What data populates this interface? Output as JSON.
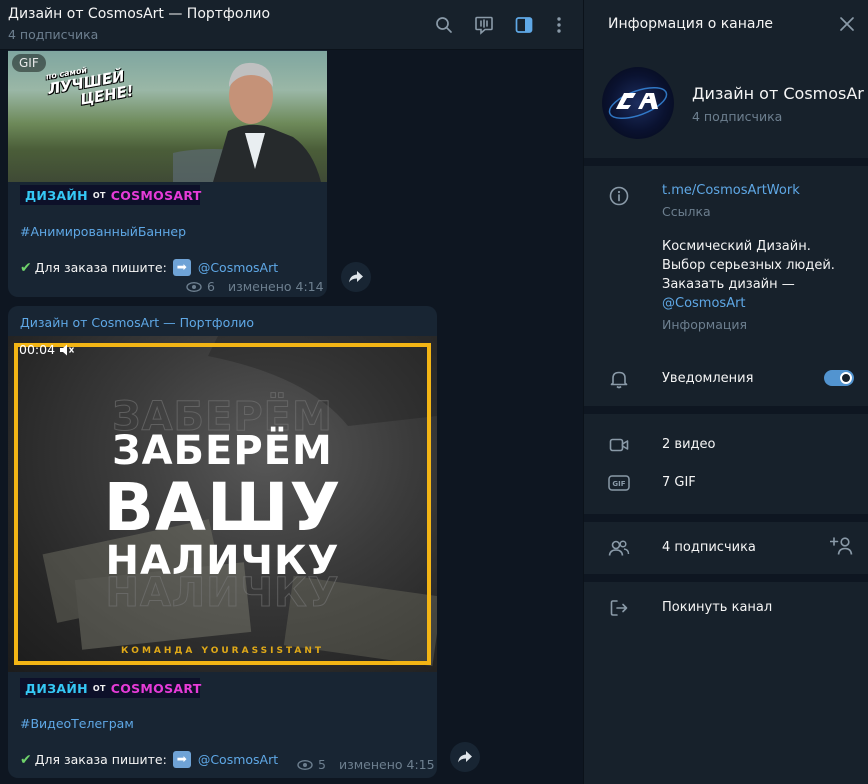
{
  "chat": {
    "title": "Дизайн от CosmosArt — Портфолио",
    "subtitle": "4 подписчика",
    "header_icons": [
      "search-icon",
      "live-stream-icon",
      "sidebar-toggle-icon",
      "more-vertical-icon"
    ]
  },
  "message1": {
    "gif_badge": "GIF",
    "gif_caption_small": "по самой",
    "gif_caption_line1": "ЛУЧШЕЙ",
    "gif_caption_line2": "ЦЕНЕ!",
    "brand_a": "ДИЗАЙН",
    "brand_b": "ОТ",
    "brand_c": "COSMOSART",
    "hashtag": "#АнимированныйБаннер",
    "order_text": "Для заказа пишите:",
    "mention": "@CosmosArt",
    "views": "6",
    "edited": "изменено 4:14"
  },
  "message2": {
    "author": "Дизайн от CosmosArt — Портфолио",
    "video_time": "00:04",
    "video_line1": "ЗАБЕРЁМ",
    "video_line2": "ВАШУ",
    "video_line3": "НАЛИЧКУ",
    "video_team": "КОМАНДА YOURASSISTANT",
    "brand_a": "ДИЗАЙН",
    "brand_b": "ОТ",
    "brand_c": "COSMOSART",
    "hashtag": "#ВидеоТелеграм",
    "order_text": "Для заказа пишите:",
    "mention": "@CosmosArt",
    "views": "5",
    "edited": "изменено 4:15"
  },
  "panel": {
    "title": "Информация о канале",
    "channel_name": "Дизайн от CosmosArt — Портфолио",
    "channel_subs": "4 подписчика",
    "link": "t.me/CosmosArtWork",
    "link_label": "Ссылка",
    "description_line1": "Космический Дизайн.",
    "description_line2": "Выбор серьезных людей.",
    "description_line3": "Заказать дизайн —",
    "description_mention": "@CosmosArt",
    "description_label": "Информация",
    "notifications": "Уведомления",
    "notifications_on": true,
    "videos": "2 видео",
    "gifs": "7 GIF",
    "members": "4 подписчика",
    "leave": "Покинуть канал"
  },
  "colors": {
    "accent": "#5fa8e6",
    "panel_bg": "#17212b",
    "chat_bg": "#0e1621",
    "bubble_bg": "#182533",
    "frame_yellow": "#f3b515"
  }
}
